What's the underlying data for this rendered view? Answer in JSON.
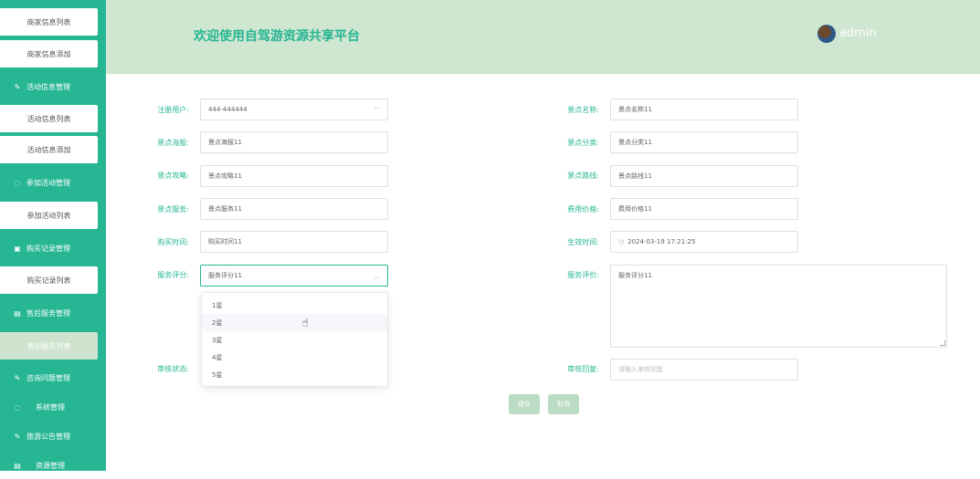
{
  "sidebar": {
    "items": [
      {
        "label": "商家信息列表"
      },
      {
        "label": "商家信息添加"
      },
      {
        "label": "活动信息管理"
      },
      {
        "label": "活动信息列表"
      },
      {
        "label": "活动信息添加"
      },
      {
        "label": "参加活动管理"
      },
      {
        "label": "参加活动列表"
      },
      {
        "label": "购买记录管理"
      },
      {
        "label": "购买记录列表"
      },
      {
        "label": "售后服务管理"
      },
      {
        "label": "售后服务列表"
      },
      {
        "label": "咨询问题管理"
      },
      {
        "label": "系统管理"
      },
      {
        "label": "旅游公告管理"
      },
      {
        "label": "资源管理"
      }
    ]
  },
  "header": {
    "title": "欢迎使用自驾游资源共享平台",
    "username": "admin"
  },
  "form": {
    "registered_user": {
      "label": "注册用户:",
      "value": "444-444444"
    },
    "scenic_name": {
      "label": "景点名称:",
      "value": "景点名称11"
    },
    "scenic_poster": {
      "label": "景点海报:",
      "value": "景点海报11"
    },
    "scenic_category": {
      "label": "景点分类:",
      "value": "景点分类11"
    },
    "scenic_guide": {
      "label": "景点攻略:",
      "value": "景点攻略11"
    },
    "scenic_route": {
      "label": "景点路线:",
      "value": "景点路线11"
    },
    "scenic_service": {
      "label": "景点服务:",
      "value": "景点服务11"
    },
    "fee_price": {
      "label": "费用价格:",
      "value": "费用价格11"
    },
    "purchase_time": {
      "label": "购买时间:",
      "value": "购买时间11"
    },
    "effective_time": {
      "label": "生效时间:",
      "value": "2024-03-19 17:21:25"
    },
    "service_rating": {
      "label": "服务评分:",
      "value": "服务评分11"
    },
    "service_review": {
      "label": "服务评价:",
      "value": "服务评分11"
    },
    "review_status": {
      "label": "审核状态:"
    },
    "review_reply": {
      "label": "审核回复:",
      "placeholder": "请输入审核回复"
    },
    "rating_options": [
      "1星",
      "2星",
      "3星",
      "4星",
      "5星"
    ],
    "submit_label": "提交",
    "cancel_label": "取消"
  },
  "colors": {
    "accent": "#26b694",
    "header_bg": "#cfe6d0",
    "button_bg": "#b9dcc3"
  }
}
